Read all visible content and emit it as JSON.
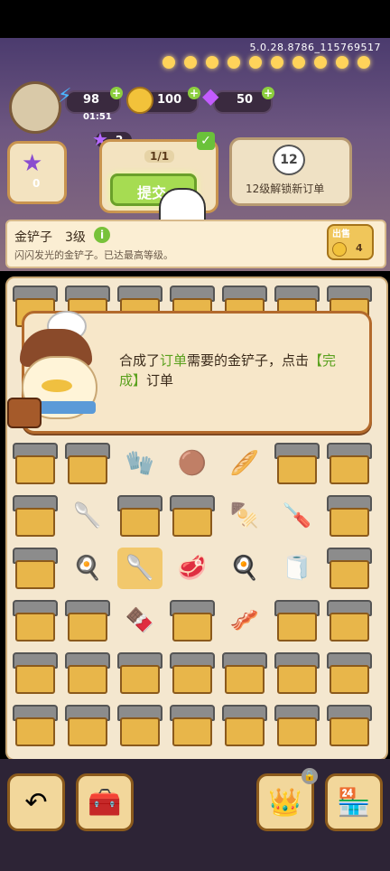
{
  "status": {
    "version": "5.0.28.8786_115769517"
  },
  "resources": {
    "energy": "98",
    "energy_timer": "01:51",
    "coins": "100",
    "gems": "50"
  },
  "level": {
    "stars": "2"
  },
  "left_card": {
    "value": "0"
  },
  "order": {
    "progress": "1/1",
    "submit_label": "提交"
  },
  "locked_order": {
    "level": "12",
    "text": "12级解锁新订单"
  },
  "info": {
    "title": "金铲子",
    "level": "3级",
    "info_icon": "i",
    "description": "闪闪发光的金铲子。已达最高等级。",
    "sell_label": "出售",
    "sell_price": "4"
  },
  "dialog": {
    "text_pre": "合成了",
    "text_highlight1": "订单",
    "text_mid": "需要的金铲子，点击",
    "text_highlight2": "【完成】",
    "text_post": "订单"
  },
  "colors": {
    "accent": "#5aa11e",
    "brand": "#c9944f"
  }
}
